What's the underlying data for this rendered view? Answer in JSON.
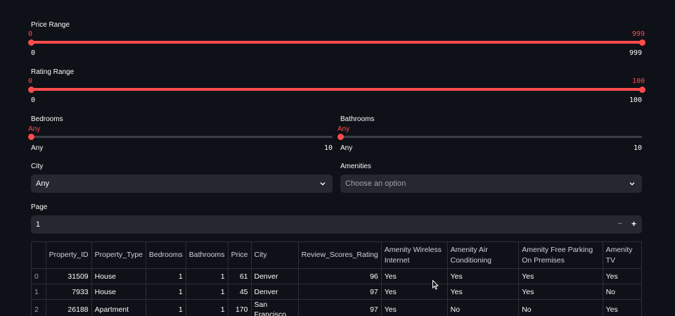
{
  "price": {
    "label": "Price Range",
    "min_value": "0",
    "max_value": "999",
    "min_bound": "0",
    "max_bound": "999"
  },
  "rating": {
    "label": "Rating Range",
    "min_value": "0",
    "max_value": "100",
    "min_bound": "0",
    "max_bound": "100"
  },
  "bedrooms": {
    "label": "Bedrooms",
    "value": "Any",
    "min_bound": "Any",
    "max_bound": "10"
  },
  "bathrooms": {
    "label": "Bathrooms",
    "value": "Any",
    "min_bound": "Any",
    "max_bound": "10"
  },
  "city": {
    "label": "City",
    "selected": "Any"
  },
  "amenities": {
    "label": "Amenities",
    "placeholder": "Choose an option"
  },
  "page": {
    "label": "Page",
    "value": "1",
    "minus": "−",
    "plus": "+"
  },
  "colors": {
    "accent": "#ff4b4b",
    "background": "#0e1117",
    "input_bg": "#262730"
  },
  "table": {
    "columns": [
      "",
      "Property_ID",
      "Property_Type",
      "Bedrooms",
      "Bathrooms",
      "Price",
      "City",
      "Review_Scores_Rating",
      "Amenity Wireless Internet",
      "Amenity Air Conditioning",
      "Amenity Free Parking On Premises",
      "Amenity TV"
    ],
    "rows": [
      [
        "0",
        "31509",
        "House",
        "1",
        "1",
        "61",
        "Denver",
        "96",
        "Yes",
        "Yes",
        "Yes",
        "Yes"
      ],
      [
        "1",
        "7933",
        "House",
        "1",
        "1",
        "45",
        "Denver",
        "97",
        "Yes",
        "Yes",
        "Yes",
        "No"
      ],
      [
        "2",
        "26188",
        "Apartment",
        "1",
        "1",
        "170",
        "San Francisco",
        "97",
        "Yes",
        "No",
        "No",
        "Yes"
      ]
    ]
  }
}
